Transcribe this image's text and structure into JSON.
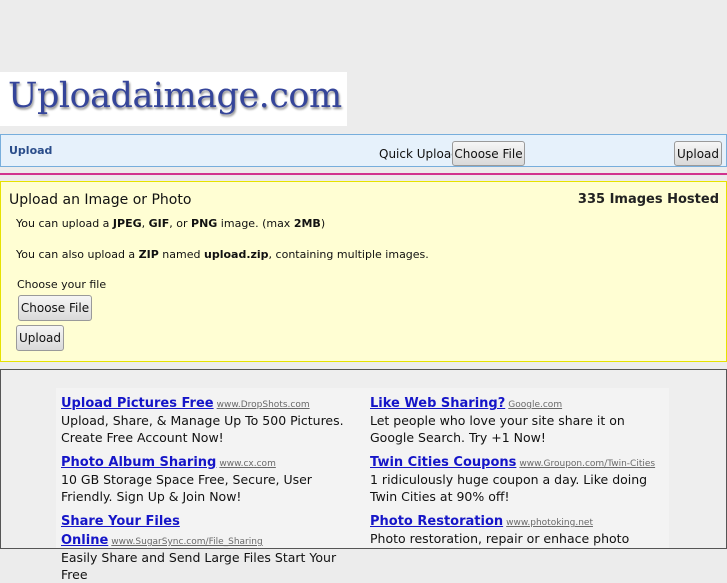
{
  "logo": "Uploadaimage.com",
  "nav": {
    "upload_link": "Upload",
    "quick_upload_label": "Quick Upload",
    "choose_file": "Choose File",
    "upload_button": "Upload"
  },
  "panel": {
    "title": "Upload an Image or Photo",
    "images_hosted": "335 Images Hosted",
    "line1": {
      "a": "You can upload a ",
      "jpeg": "JPEG",
      "b": ", ",
      "gif": "GIF",
      "c": ", or ",
      "png": "PNG",
      "d": " image. (max ",
      "max": "2MB",
      "e": ")"
    },
    "line2": {
      "a": "You can also upload a ",
      "zip": "ZIP",
      "b": " named ",
      "file": "upload.zip",
      "c": ", containing multiple images."
    },
    "choose_label": "Choose your file",
    "choose_file": "Choose File",
    "upload_button": "Upload"
  },
  "ads": [
    {
      "title": "Upload Pictures Free",
      "url": "www.DropShots.com",
      "body": "Upload, Share, & Manage Up To 500 Pictures. Create Free Account Now!"
    },
    {
      "title": "Like Web Sharing?",
      "url": "Google.com",
      "body": "Let people who love your site share it on Google Search. Try +1 Now!"
    },
    {
      "title": "Photo Album Sharing",
      "url": "www.cx.com",
      "body": "10 GB Storage Space Free, Secure, User Friendly. Sign Up & Join Now!"
    },
    {
      "title": "Twin Cities Coupons",
      "url": "www.Groupon.com/Twin-Cities",
      "body": "1 ridiculously huge coupon a day. Like doing Twin Cities at 90% off!"
    },
    {
      "title": "Share Your Files Online",
      "url": "www.SugarSync.com/File_Sharing",
      "body": "Easily Share and Send Large Files Start Your Free"
    },
    {
      "title": "Photo Restoration",
      "url": "www.photoking.net",
      "body": "Photo restoration, repair or enhace photo"
    }
  ]
}
